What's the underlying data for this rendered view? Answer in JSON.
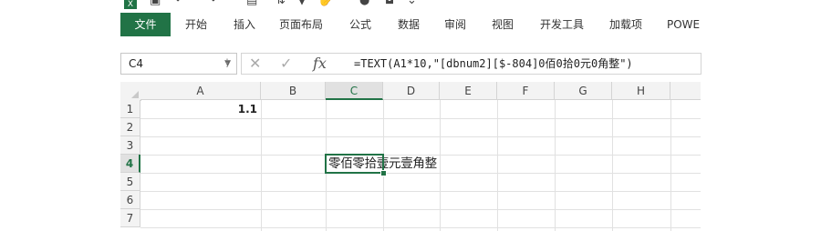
{
  "ribbon": {
    "tabs": [
      "文件",
      "开始",
      "插入",
      "页面布局",
      "公式",
      "数据",
      "审阅",
      "视图",
      "开发工具",
      "加载项",
      "POWE"
    ]
  },
  "formula_bar": {
    "name_box": "C4",
    "fx_label": "fx",
    "formula": "=TEXT(A1*10,\"[dbnum2][$-804]0佰0拾0元0角整\")"
  },
  "sheet": {
    "columns": [
      "A",
      "B",
      "C",
      "D",
      "E",
      "F",
      "G",
      "H"
    ],
    "rows": [
      "1",
      "2",
      "3",
      "4",
      "5",
      "6",
      "7"
    ],
    "selected_cell": "C4",
    "cells": {
      "A1": "1.1",
      "C4": "零佰零拾壹元壹角整"
    }
  }
}
